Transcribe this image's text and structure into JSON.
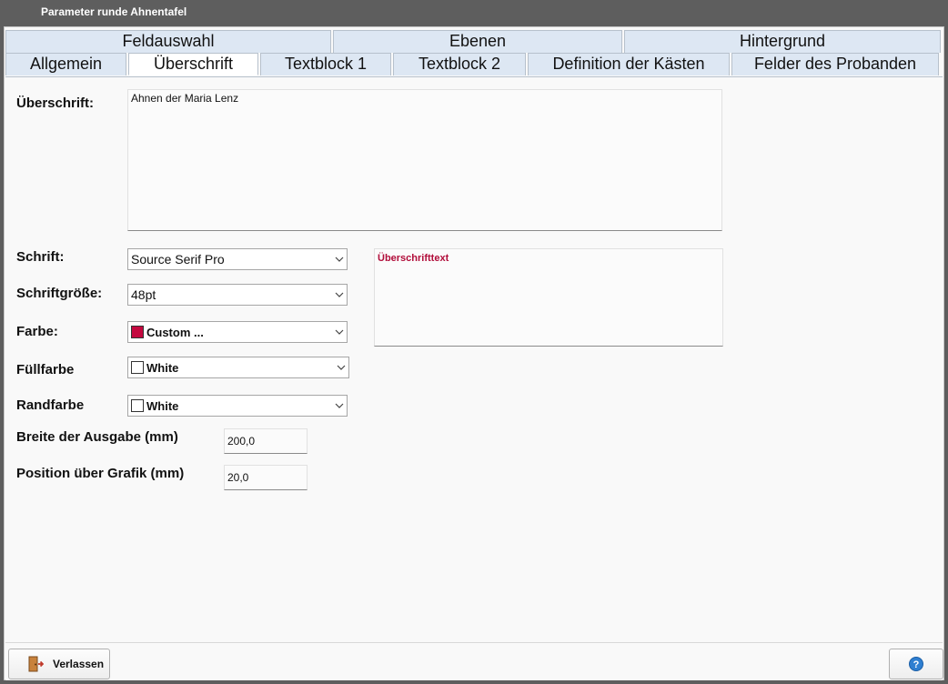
{
  "window": {
    "title": "Parameter runde Ahnentafel"
  },
  "tabs": {
    "row1": [
      {
        "label": "Feldauswahl"
      },
      {
        "label": "Ebenen"
      },
      {
        "label": "Hintergrund"
      }
    ],
    "row2": [
      {
        "label": "Allgemein"
      },
      {
        "label": "Überschrift"
      },
      {
        "label": "Textblock 1"
      },
      {
        "label": "Textblock 2"
      },
      {
        "label": "Definition der Kästen"
      },
      {
        "label": "Felder des Probanden"
      }
    ],
    "active": "Überschrift"
  },
  "form": {
    "heading": {
      "label": "Überschrift:",
      "value": "Ahnen der Maria Lenz"
    },
    "font": {
      "label": "Schrift:",
      "value": "Source Serif Pro"
    },
    "size": {
      "label": "Schriftgröße:",
      "value": "48pt"
    },
    "color": {
      "label": "Farbe:",
      "value": "Custom ...",
      "swatch": "#c4093f"
    },
    "fill": {
      "label": "Füllfarbe",
      "value": "White",
      "swatch": "#ffffff"
    },
    "border": {
      "label": "Randfarbe",
      "value": "White",
      "swatch": "#ffffff"
    },
    "width": {
      "label": "Breite der Ausgabe (mm)",
      "value": "200,0"
    },
    "position": {
      "label": "Position über Grafik (mm)",
      "value": "20,0"
    },
    "preview": {
      "text": "Überschrifttext",
      "color": "#b10d3a"
    }
  },
  "footer": {
    "exit_label": "Verlassen",
    "exit_icon": "door-exit-icon",
    "help_icon": "help-question-icon"
  }
}
